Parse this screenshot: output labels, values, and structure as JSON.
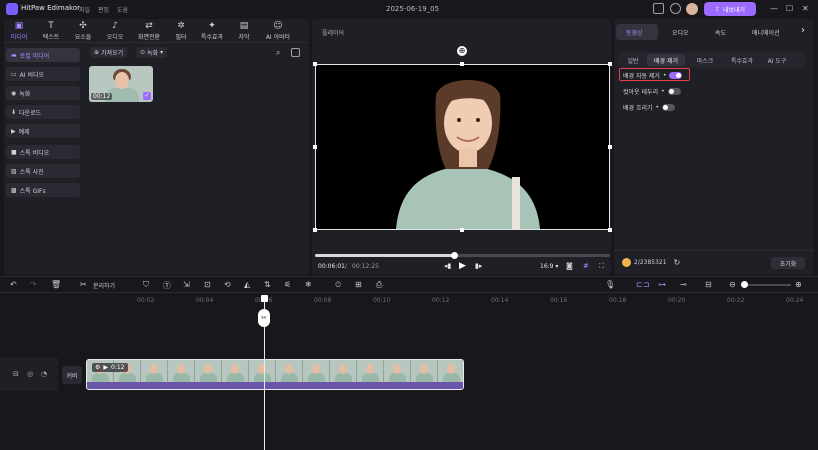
{
  "app": {
    "name": "HitPaw Edimakor",
    "menu": [
      "파일",
      "편집",
      "도움"
    ],
    "document_title": "2025-06-19_05",
    "export_label": "내보내기"
  },
  "colors": {
    "accent": "#9b6bff",
    "highlight": "#e0404a",
    "background": "#17171c",
    "panel": "#1f1f26"
  },
  "media_tabs": [
    {
      "label": "미디어",
      "icon": "media-icon"
    },
    {
      "label": "텍스트",
      "icon": "text-icon"
    },
    {
      "label": "요소들",
      "icon": "elements-icon"
    },
    {
      "label": "오디오",
      "icon": "audio-icon"
    },
    {
      "label": "화면전환",
      "icon": "transition-icon"
    },
    {
      "label": "필터",
      "icon": "filter-icon"
    },
    {
      "label": "특수효과",
      "icon": "effects-icon"
    },
    {
      "label": "자막",
      "icon": "subtitle-icon"
    },
    {
      "label": "AI 아바타",
      "icon": "avatar-icon"
    }
  ],
  "sidebar": {
    "items": [
      "로컬 미디어",
      "AI 비디오",
      "녹화",
      "다운로드",
      "예제",
      "스톡 비디오",
      "스톡 사진",
      "스톡 GIFs"
    ]
  },
  "media_bar": {
    "import_label": "가져오기",
    "record_label": "녹화"
  },
  "media_item": {
    "duration": "00:12"
  },
  "player": {
    "title": "플레이어",
    "current_time": "00:06:01",
    "total_time": "00:12:25",
    "aspect": "16:9",
    "progress": 0.47
  },
  "right_panel": {
    "tabs": [
      "동영상",
      "오디오",
      "속도",
      "애니메이션"
    ],
    "sub_tabs": [
      "일반",
      "배경 제거",
      "마스크",
      "특수효과",
      "AI 도구"
    ],
    "options": [
      {
        "label": "배경 자동 제거",
        "on": true
      },
      {
        "label": "컷아웃 테두리",
        "on": false
      },
      {
        "label": "배경 흐리기",
        "on": false
      }
    ],
    "credits": "2/2385321",
    "reset_label": "초기화"
  },
  "timeline": {
    "split_label": "분리하기",
    "ruler": [
      "00:02",
      "00:04",
      "00:06",
      "00:08",
      "00:10",
      "00:12",
      "00:14",
      "00:16",
      "00:18",
      "00:20",
      "00:22",
      "00:24"
    ],
    "clip_duration": "0:12",
    "cover_label": "커버"
  }
}
